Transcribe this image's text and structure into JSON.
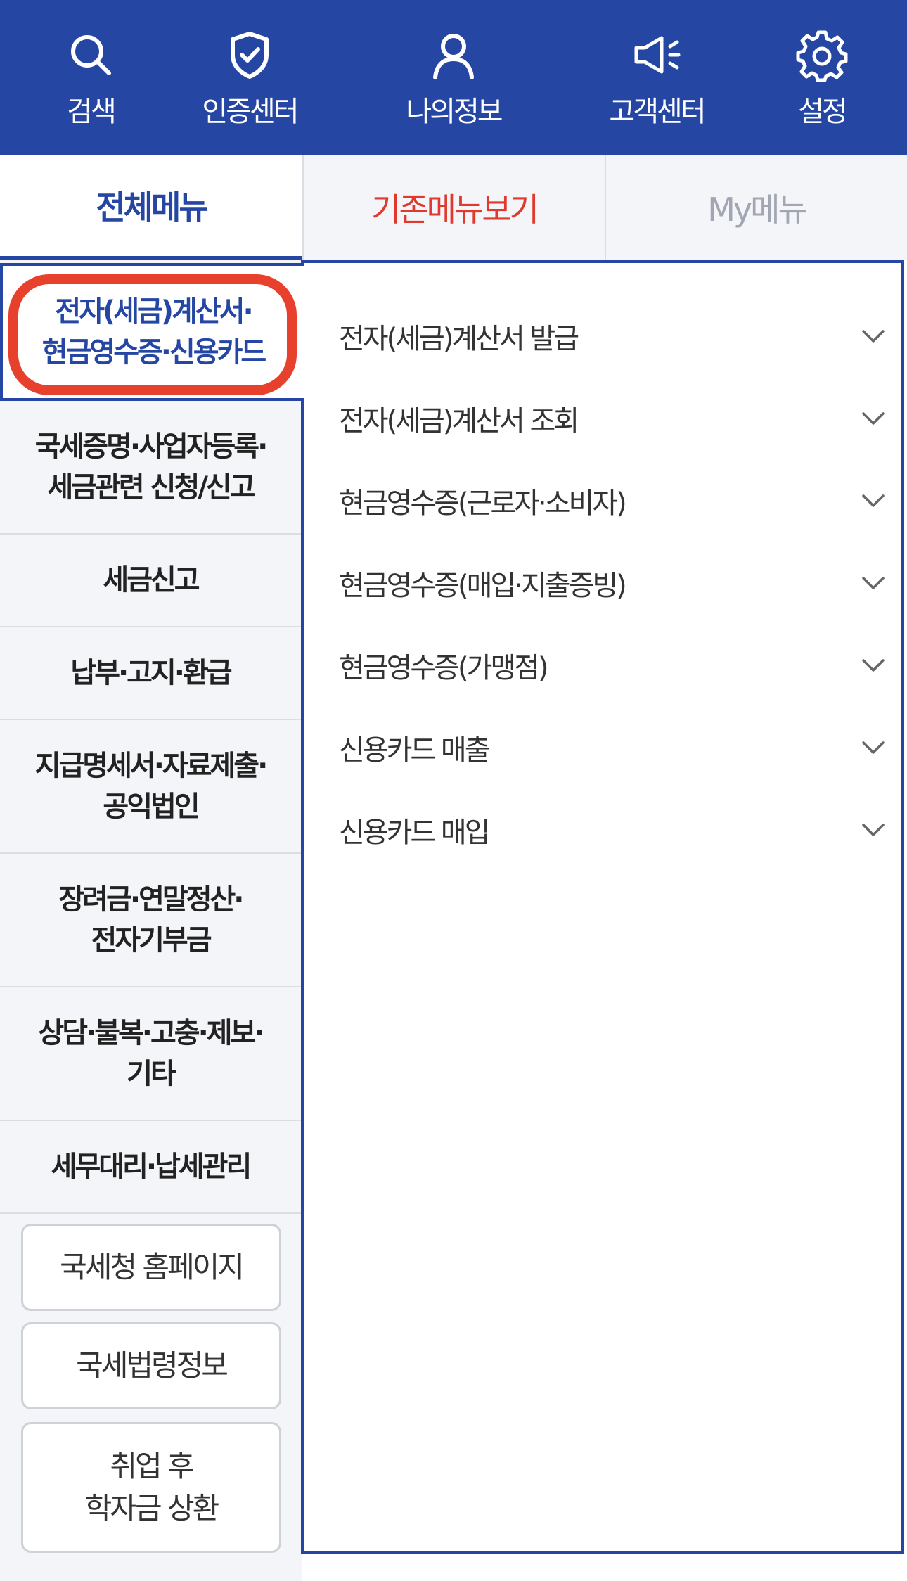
{
  "topnav": {
    "items": [
      {
        "label": "검색",
        "icon": "search-icon"
      },
      {
        "label": "인증센터",
        "icon": "shield-check-icon"
      },
      {
        "label": "나의정보",
        "icon": "user-icon"
      },
      {
        "label": "고객센터",
        "icon": "megaphone-icon"
      },
      {
        "label": "설정",
        "icon": "gear-icon"
      }
    ]
  },
  "tabs": [
    {
      "label": "전체메뉴"
    },
    {
      "label": "기존메뉴보기"
    },
    {
      "label": "My메뉴"
    }
  ],
  "leftmenu": {
    "items": [
      {
        "label": "전자(세금)계산서·\n현금영수증·신용카드"
      },
      {
        "label": "국세증명·사업자등록·\n세금관련 신청/신고"
      },
      {
        "label": "세금신고"
      },
      {
        "label": "납부·고지·환급"
      },
      {
        "label": "지급명세서·자료제출·\n공익법인"
      },
      {
        "label": "장려금·연말정산·\n전자기부금"
      },
      {
        "label": "상담·불복·고충·제보·\n기타"
      },
      {
        "label": "세무대리·납세관리"
      }
    ],
    "buttons": [
      {
        "label": "국세청 홈페이지"
      },
      {
        "label": "국세법령정보"
      },
      {
        "label": "취업 후\n학자금 상환"
      }
    ]
  },
  "submenu": {
    "items": [
      {
        "label": "전자(세금)계산서 발급"
      },
      {
        "label": "전자(세금)계산서 조회"
      },
      {
        "label": "현금영수증(근로자·소비자)"
      },
      {
        "label": "현금영수증(매입·지출증빙)"
      },
      {
        "label": "현금영수증(가맹점)"
      },
      {
        "label": "신용카드 매출"
      },
      {
        "label": "신용카드 매입"
      }
    ]
  },
  "colors": {
    "primary": "#2547a3",
    "accent_red": "#e03a2f",
    "highlight_ring": "#e7412e",
    "muted": "#a2a6b3",
    "menu_bg": "#f4f5f9"
  }
}
